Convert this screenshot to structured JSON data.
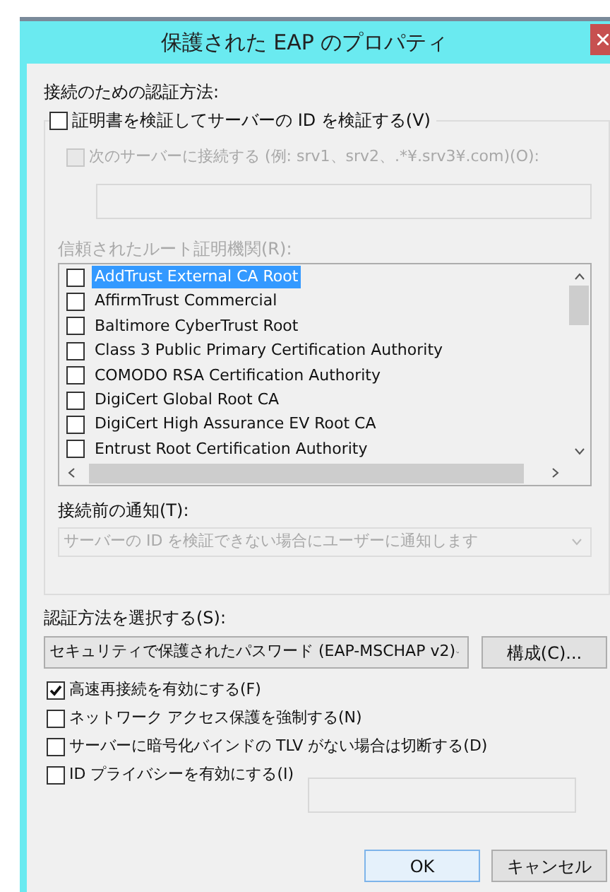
{
  "window": {
    "title": "保護された EAP のプロパティ"
  },
  "auth_section": {
    "label": "接続のための認証方法:",
    "verify_server": {
      "label": "証明書を検証してサーバーの ID を検証する(V)",
      "checked": false
    },
    "connect_servers": {
      "label": "次のサーバーに接続する (例: srv1、srv2、.*¥.srv3¥.com)(O):",
      "checked": false,
      "disabled": true
    },
    "trusted_ca_label": "信頼されたルート証明機関(R):",
    "trusted_ca": [
      {
        "label": "AddTrust External CA Root",
        "checked": false,
        "selected": true
      },
      {
        "label": "AffirmTrust Commercial",
        "checked": false,
        "selected": false
      },
      {
        "label": "Baltimore CyberTrust Root",
        "checked": false,
        "selected": false
      },
      {
        "label": "Class 3 Public Primary Certification Authority",
        "checked": false,
        "selected": false
      },
      {
        "label": "COMODO RSA Certification Authority",
        "checked": false,
        "selected": false
      },
      {
        "label": "DigiCert Global Root CA",
        "checked": false,
        "selected": false
      },
      {
        "label": "DigiCert High Assurance EV Root CA",
        "checked": false,
        "selected": false
      },
      {
        "label": "Entrust Root Certification Authority",
        "checked": false,
        "selected": false
      }
    ],
    "notify_label": "接続前の通知(T):",
    "notify_value": "サーバーの ID を検証できない場合にユーザーに通知します"
  },
  "method_label": "認証方法を選択する(S):",
  "method_value": "セキュリティで保護されたパスワード (EAP-MSCHAP v2)",
  "configure_button": "構成(C)...",
  "options": [
    {
      "label": "高速再接続を有効にする(F)",
      "checked": true
    },
    {
      "label": "ネットワーク アクセス保護を強制する(N)",
      "checked": false
    },
    {
      "label": "サーバーに暗号化バインドの TLV がない場合は切断する(D)",
      "checked": false
    },
    {
      "label": "ID プライバシーを有効にする(I)",
      "checked": false
    }
  ],
  "buttons": [
    {
      "label": "OK",
      "kind": "default"
    },
    {
      "label": "キャンセル",
      "kind": "normal"
    }
  ]
}
